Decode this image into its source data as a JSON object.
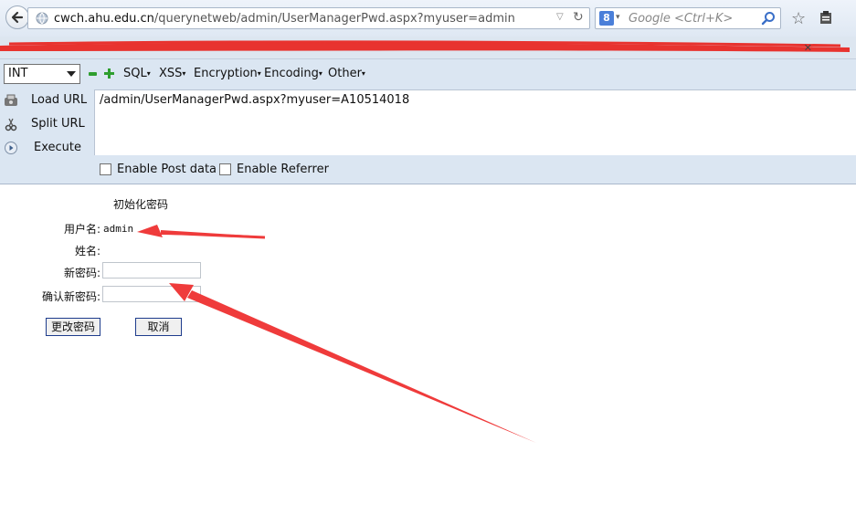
{
  "browser": {
    "url_host": "cwch.ahu.edu.cn",
    "url_path": "/querynetweb/admin/UserManagerPwd.aspx?myuser=admin",
    "search_placeholder": "Google <Ctrl+K>",
    "search_engine_badge": "8"
  },
  "hackbar": {
    "type_select": "INT",
    "menus": [
      "SQL",
      "XSS",
      "Encryption",
      "Encoding",
      "Other"
    ],
    "load_url_label": "Load URL",
    "split_url_label": "Split URL",
    "execute_label": "Execute",
    "url_value": "/admin/UserManagerPwd.aspx?myuser=A10514018",
    "enable_post_label": "Enable Post data",
    "enable_referrer_label": "Enable Referrer"
  },
  "form": {
    "title": "初始化密码",
    "username_label": "用户名:",
    "username_value": "admin",
    "name_label": "姓名:",
    "new_password_label": "新密码:",
    "confirm_password_label": "确认新密码:",
    "submit_label": "更改密码",
    "cancel_label": "取消"
  },
  "colors": {
    "annotation_arrow": "#ef3b3b",
    "redaction": "#e8332f",
    "button_border": "#1e3c8c"
  }
}
